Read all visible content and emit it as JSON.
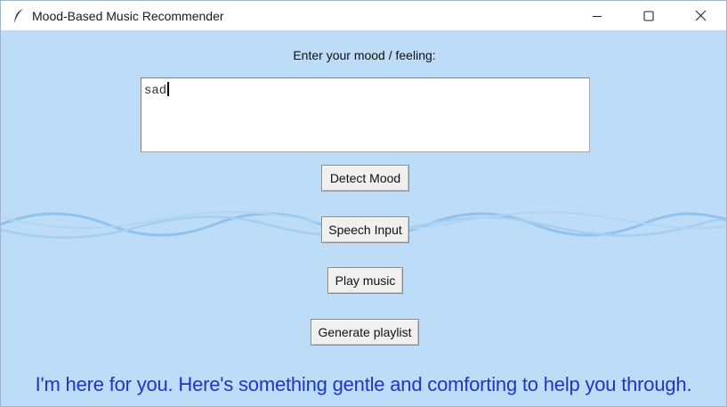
{
  "window": {
    "title": "Mood-Based Music Recommender",
    "icon": "feather-icon",
    "controls": [
      "minimize-icon",
      "maximize-icon",
      "close-icon"
    ]
  },
  "main": {
    "prompt_label": "Enter your mood / feeling:",
    "mood_input_value": "sad",
    "buttons": {
      "detect_mood": "Detect Mood",
      "speech_input": "Speech Input",
      "play_music": "Play music",
      "generate_playlist": "Generate playlist"
    },
    "message": "I'm here for you. Here's something gentle and comforting to help you through."
  },
  "colors": {
    "background": "#bcdcf7",
    "message_text": "#1f35c8",
    "wave": "#8fc3ee"
  }
}
